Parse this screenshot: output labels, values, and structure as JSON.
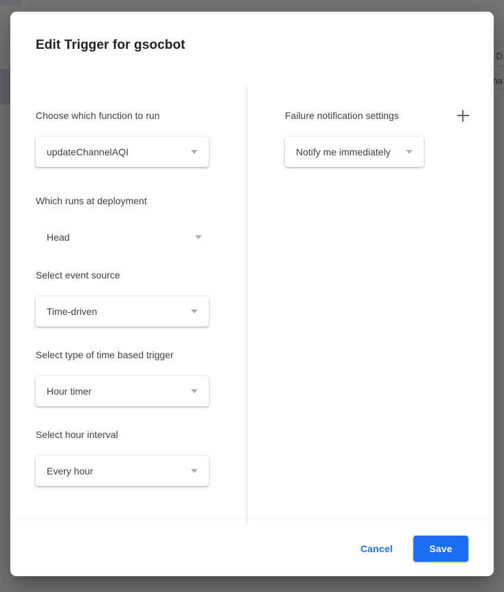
{
  "background": {
    "right_edge_texts": [
      "D",
      "na"
    ]
  },
  "dialog": {
    "title": "Edit Trigger for gsocbot",
    "left_column": {
      "fields": [
        {
          "label": "Choose which function to run",
          "value": "updateChannelAQI",
          "name": "function-to-run",
          "style": "card"
        },
        {
          "label": "Which runs at deployment",
          "value": "Head",
          "name": "deployment",
          "style": "flat"
        },
        {
          "label": "Select event source",
          "value": "Time-driven",
          "name": "event-source",
          "style": "card"
        },
        {
          "label": "Select type of time based trigger",
          "value": "Hour timer",
          "name": "time-based-trigger-type",
          "style": "card"
        },
        {
          "label": "Select hour interval",
          "value": "Every hour",
          "name": "hour-interval",
          "style": "card"
        }
      ]
    },
    "right_column": {
      "label": "Failure notification settings",
      "add_icon": "plus-icon",
      "value": "Notify me immediately"
    },
    "footer": {
      "cancel_label": "Cancel",
      "save_label": "Save"
    },
    "colors": {
      "accent_blue": "#1b6ef3",
      "link_blue": "#1a73e8",
      "text_primary": "#202124",
      "text_secondary": "#3c4043",
      "divider": "#dadce0",
      "caret": "#b0b0b0"
    }
  }
}
